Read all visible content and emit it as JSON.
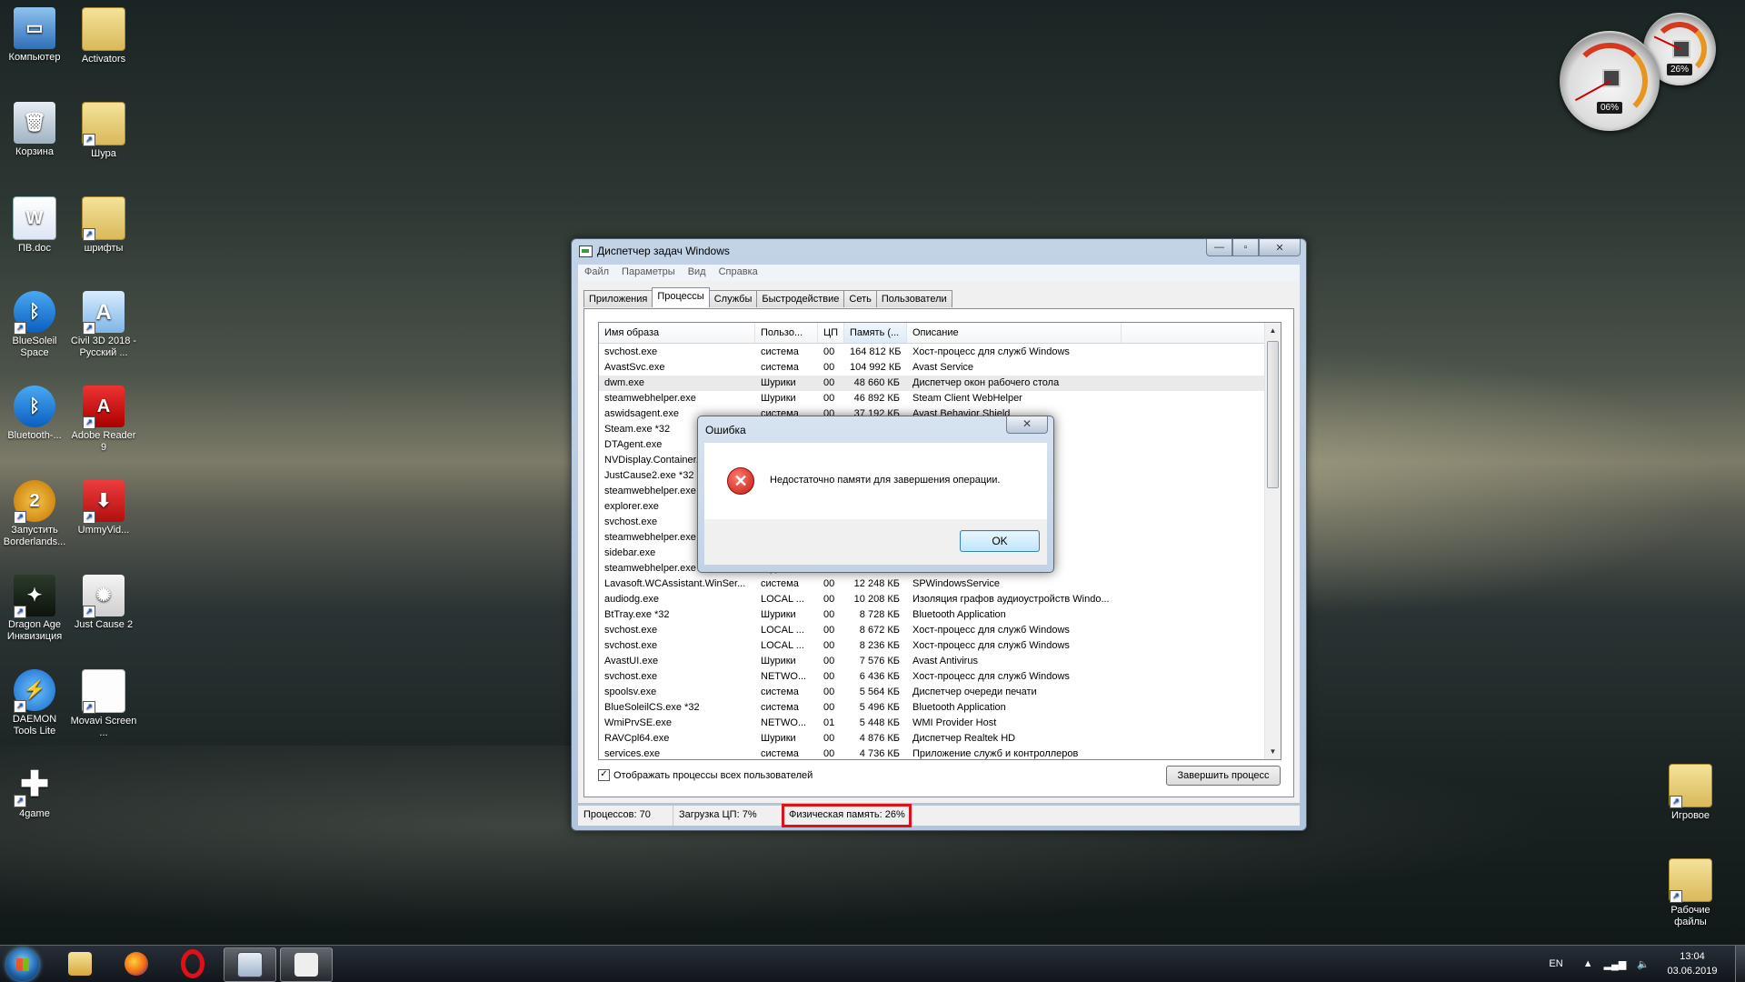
{
  "desktop": {
    "icons": [
      {
        "label": "Компьютер"
      },
      {
        "label": "Activators"
      },
      {
        "label": "Корзина"
      },
      {
        "label": "Шура"
      },
      {
        "label": "ПВ.doc"
      },
      {
        "label": "шрифты"
      },
      {
        "label": "BlueSoleil Space"
      },
      {
        "label": "Civil 3D 2018 - Русский ..."
      },
      {
        "label": "Bluetooth-..."
      },
      {
        "label": "Adobe Reader 9"
      },
      {
        "label": "Запустить Borderlands..."
      },
      {
        "label": "UmmyVid..."
      },
      {
        "label": "Dragon Age Инквизиция"
      },
      {
        "label": "Just Cause 2"
      },
      {
        "label": "DAEMON Tools Lite"
      },
      {
        "label": "Movavi Screen ..."
      },
      {
        "label": "4game"
      },
      {
        "label": "Игровое"
      },
      {
        "label": "Рабочие файлы"
      }
    ]
  },
  "gadgets": {
    "cpu": {
      "value_text": "06%",
      "percent": 6
    },
    "ram": {
      "value_text": "26%",
      "percent": 26
    }
  },
  "taskmgr": {
    "title": "Диспетчер задач Windows",
    "menu": [
      "Файл",
      "Параметры",
      "Вид",
      "Справка"
    ],
    "tabs": [
      "Приложения",
      "Процессы",
      "Службы",
      "Быстродействие",
      "Сеть",
      "Пользователи"
    ],
    "active_tab": "Процессы",
    "columns": [
      "Имя образа",
      "Пользо...",
      "ЦП",
      "Память (...",
      "Описание"
    ],
    "rows": [
      [
        "svchost.exe",
        "система",
        "00",
        "164 812 КБ",
        "Хост-процесс для служб Windows"
      ],
      [
        "AvastSvc.exe",
        "система",
        "00",
        "104 992 КБ",
        "Avast Service"
      ],
      [
        "dwm.exe",
        "Шурики",
        "00",
        "48 660 КБ",
        "Диспетчер окон рабочего стола"
      ],
      [
        "steamwebhelper.exe",
        "Шурики",
        "00",
        "46 892 КБ",
        "Steam Client WebHelper"
      ],
      [
        "aswidsagent.exe",
        "система",
        "00",
        "37 192 КБ",
        "Avast Behavior Shield"
      ],
      [
        "Steam.exe *32",
        "",
        "",
        "",
        ""
      ],
      [
        "DTAgent.exe",
        "",
        "",
        "",
        ""
      ],
      [
        "NVDisplay.Container....",
        "",
        "",
        "",
        ""
      ],
      [
        "JustCause2.exe *32",
        "",
        "",
        "",
        ""
      ],
      [
        "steamwebhelper.exe",
        "",
        "",
        "",
        ""
      ],
      [
        "explorer.exe",
        "",
        "",
        "",
        ""
      ],
      [
        "svchost.exe",
        "",
        "",
        "",
        "ows"
      ],
      [
        "steamwebhelper.exe",
        "",
        "",
        "",
        ""
      ],
      [
        "sidebar.exe",
        "",
        "",
        "",
        "lows"
      ],
      [
        "steamwebhelper.exe",
        "Шурики",
        "",
        "",
        ""
      ],
      [
        "Lavasoft.WCAssistant.WinSer...",
        "система",
        "00",
        "12 248 КБ",
        "SPWindowsService"
      ],
      [
        "audiodg.exe",
        "LOCAL ...",
        "00",
        "10 208 КБ",
        "Изоляция графов аудиоустройств Windo..."
      ],
      [
        "BtTray.exe *32",
        "Шурики",
        "00",
        "8 728 КБ",
        "Bluetooth Application"
      ],
      [
        "svchost.exe",
        "LOCAL ...",
        "00",
        "8 672 КБ",
        "Хост-процесс для служб Windows"
      ],
      [
        "svchost.exe",
        "LOCAL ...",
        "00",
        "8 236 КБ",
        "Хост-процесс для служб Windows"
      ],
      [
        "AvastUI.exe",
        "Шурики",
        "00",
        "7 576 КБ",
        "Avast Antivirus"
      ],
      [
        "svchost.exe",
        "NETWO...",
        "00",
        "6 436 КБ",
        "Хост-процесс для служб Windows"
      ],
      [
        "spoolsv.exe",
        "система",
        "00",
        "5 564 КБ",
        "Диспетчер очереди печати"
      ],
      [
        "BlueSoleilCS.exe *32",
        "система",
        "00",
        "5 496 КБ",
        "Bluetooth Application"
      ],
      [
        "WmiPrvSE.exe",
        "NETWO...",
        "01",
        "5 448 КБ",
        "WMI Provider Host"
      ],
      [
        "RAVCpl64.exe",
        "Шурики",
        "00",
        "4 876 КБ",
        "Диспетчер Realtek HD"
      ],
      [
        "services.exe",
        "система",
        "00",
        "4 736 КБ",
        "Приложение служб и контроллеров"
      ]
    ],
    "show_all_label": "Отображать процессы всех пользователей",
    "end_process_label": "Завершить процесс",
    "status": {
      "processes": "Процессов: 70",
      "cpu": "Загрузка ЦП: 7%",
      "memory": "Физическая память: 26%"
    }
  },
  "dialog": {
    "title": "Ошибка",
    "message": "Недостаточно памяти для завершения операции.",
    "ok_label": "OK"
  },
  "taskbar": {
    "lang": "EN",
    "time": "13:04",
    "date": "03.06.2019"
  }
}
